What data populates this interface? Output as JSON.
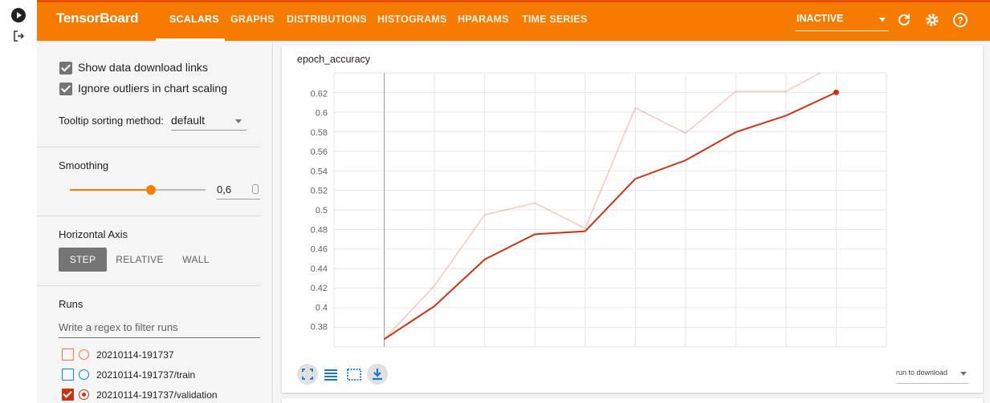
{
  "header": {
    "brand": "TensorBoard",
    "tabs": [
      {
        "label": "SCALARS",
        "active": true
      },
      {
        "label": "GRAPHS",
        "active": false
      },
      {
        "label": "DISTRIBUTIONS",
        "active": false
      },
      {
        "label": "HISTOGRAMS",
        "active": false
      },
      {
        "label": "HPARAMS",
        "active": false
      },
      {
        "label": "TIME SERIES",
        "active": false
      }
    ],
    "status": "INACTIVE",
    "icons": [
      "refresh-icon",
      "gear-icon",
      "help-icon"
    ],
    "color": "#f57c00"
  },
  "sidebar": {
    "show_download_links": {
      "label": "Show data download links",
      "checked": true
    },
    "ignore_outliers": {
      "label": "Ignore outliers in chart scaling",
      "checked": true
    },
    "tooltip_sorting": {
      "label": "Tooltip sorting method:",
      "value": "default"
    },
    "smoothing": {
      "title": "Smoothing",
      "value": "0,6",
      "fraction": 0.6
    },
    "horizontal_axis": {
      "title": "Horizontal Axis",
      "options": [
        {
          "label": "STEP",
          "active": true
        },
        {
          "label": "RELATIVE",
          "active": false
        },
        {
          "label": "WALL",
          "active": false
        }
      ]
    },
    "runs": {
      "title": "Runs",
      "filter_placeholder": "Write a regex to filter runs",
      "items": [
        {
          "label": "20210114-191737",
          "checked": false,
          "color": "#ff7043"
        },
        {
          "label": "20210114-191737/train",
          "checked": false,
          "color": "#0288d1"
        },
        {
          "label": "20210114-191737/validation",
          "checked": true,
          "color": "#cc3311"
        }
      ]
    }
  },
  "chart": {
    "title": "epoch_accuracy",
    "download_select": "run to download",
    "controls": [
      "fit-domain-icon",
      "toggle-log-scale-icon",
      "select-region-icon",
      "download-icon"
    ]
  },
  "chart_data": {
    "type": "line",
    "title": "epoch_accuracy",
    "x": [
      0,
      1,
      2,
      3,
      4,
      5,
      6,
      7,
      8,
      9
    ],
    "xlim": [
      -1,
      10
    ],
    "ylim": [
      0.359,
      0.641
    ],
    "yticks": [
      0.38,
      0.4,
      0.42,
      0.44,
      0.46,
      0.48,
      0.5,
      0.52,
      0.54,
      0.56,
      0.58,
      0.6,
      0.62
    ],
    "grid": true,
    "series": [
      {
        "name": "20210114-191737/validation",
        "color": "#cc3311",
        "opacity": 1.0,
        "values": [
          0.367,
          0.401,
          0.449,
          0.475,
          0.478,
          0.532,
          0.551,
          0.58,
          0.597,
          0.621
        ]
      },
      {
        "name": "20210114-191737/validation (raw)",
        "color": "#cc3311",
        "opacity": 0.25,
        "values": [
          0.367,
          0.422,
          0.495,
          0.507,
          0.481,
          0.605,
          0.579,
          0.622,
          0.622,
          0.65
        ]
      }
    ]
  }
}
